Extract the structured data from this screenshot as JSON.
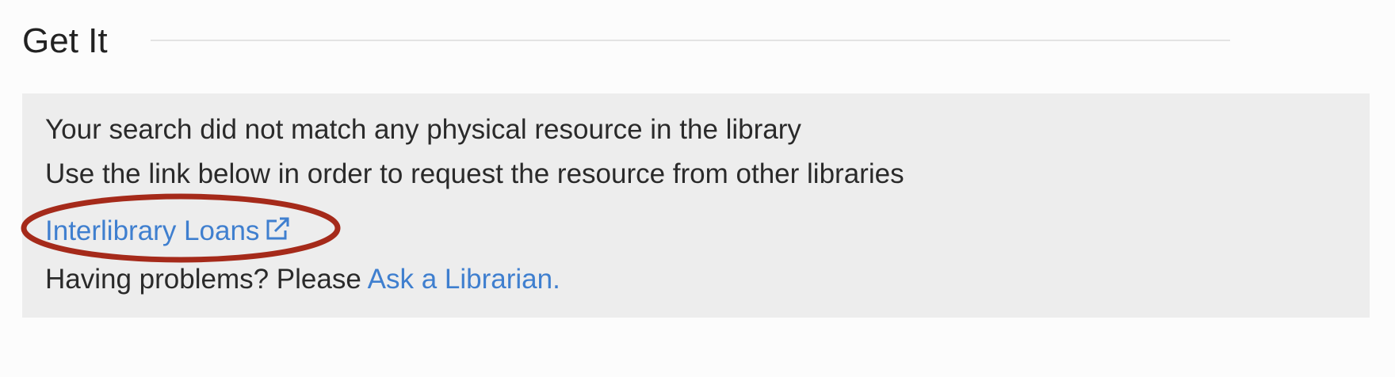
{
  "section": {
    "title": "Get It"
  },
  "notice": {
    "line1": "Your search did not match any physical resource in the library",
    "line2": "Use the link below in order to request the resource from other libraries",
    "ill_link_label": "Interlibrary Loans",
    "help_prefix": "Having problems? Please",
    "help_link_label": "Ask a Librarian."
  },
  "icons": {
    "external": "external-link-icon"
  },
  "colors": {
    "link": "#3f7fcf",
    "panel_bg": "#ededed",
    "annotation": "#a52a1a"
  }
}
